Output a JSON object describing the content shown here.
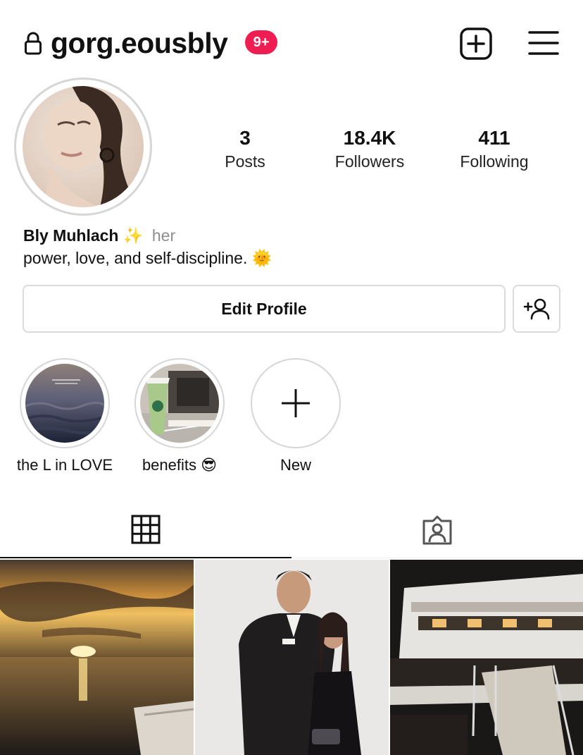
{
  "header": {
    "username": "gorg.eousbly",
    "notification_badge": "9+",
    "lock_icon": "lock-icon",
    "add_icon": "plus-square-icon",
    "menu_icon": "hamburger-menu-icon"
  },
  "stats": [
    {
      "value": "3",
      "label": "Posts"
    },
    {
      "value": "18.4K",
      "label": "Followers"
    },
    {
      "value": "411",
      "label": "Following"
    }
  ],
  "bio": {
    "name": "Bly Muhlach",
    "sparkle_emoji": "✨",
    "pronoun": "her",
    "text": "power, love, and self-discipline.",
    "sun_emoji": "🌞"
  },
  "buttons": {
    "edit_profile": "Edit Profile",
    "discover_icon": "add-person-icon"
  },
  "highlights": [
    {
      "label": "the L in LOVE"
    },
    {
      "label": "benefits",
      "emoji": "😎"
    },
    {
      "label": "New"
    }
  ],
  "tabs": [
    {
      "icon": "grid-icon",
      "active": true
    },
    {
      "icon": "tagged-person-icon",
      "active": false
    }
  ],
  "posts": [
    {
      "subject": "sunset over ocean"
    },
    {
      "subject": "couple in formal attire"
    },
    {
      "subject": "yacht at night"
    }
  ],
  "colors": {
    "badge": "#ee1d52",
    "border": "#dbdbdb",
    "text": "#111111",
    "muted": "#8e8e8e"
  }
}
